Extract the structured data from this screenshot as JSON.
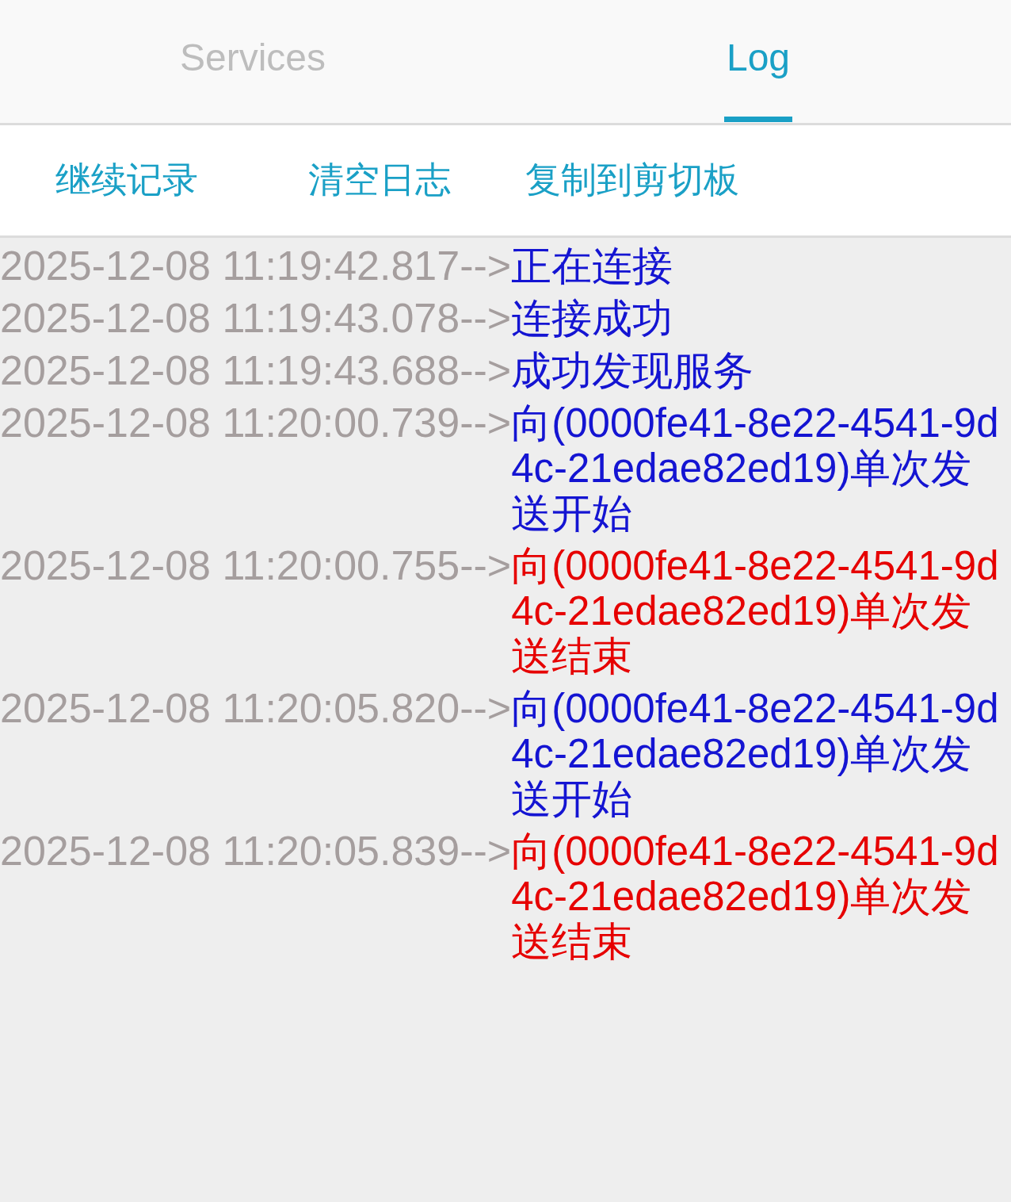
{
  "tabs": [
    {
      "label": "Services",
      "selected": false
    },
    {
      "label": "Log",
      "selected": true
    }
  ],
  "toolbar": {
    "buttons": [
      "继续记录",
      "清空日志",
      "复制到剪切板"
    ]
  },
  "log": [
    {
      "time": "2025-12-08 11:19:42.817-->",
      "message": "正在连接",
      "color": "#1414d2"
    },
    {
      "time": "2025-12-08 11:19:43.078-->",
      "message": "连接成功",
      "color": "#1414d2"
    },
    {
      "time": "2025-12-08 11:19:43.688-->",
      "message": "成功发现服务",
      "color": "#1414d2"
    },
    {
      "time": "2025-12-08 11:20:00.739-->",
      "message": "向(0000fe41-8e22-4541-9d4c-21edae82ed19)单次发送开始",
      "color": "#1414d2"
    },
    {
      "time": "2025-12-08 11:20:00.755-->",
      "message": "向(0000fe41-8e22-4541-9d4c-21edae82ed19)单次发送结束",
      "color": "#e60000"
    },
    {
      "time": "2025-12-08 11:20:05.820-->",
      "message": "向(0000fe41-8e22-4541-9d4c-21edae82ed19)单次发送开始",
      "color": "#1414d2"
    },
    {
      "time": "2025-12-08 11:20:05.839-->",
      "message": "向(0000fe41-8e22-4541-9d4c-21edae82ed19)单次发送结束",
      "color": "#e60000"
    }
  ]
}
